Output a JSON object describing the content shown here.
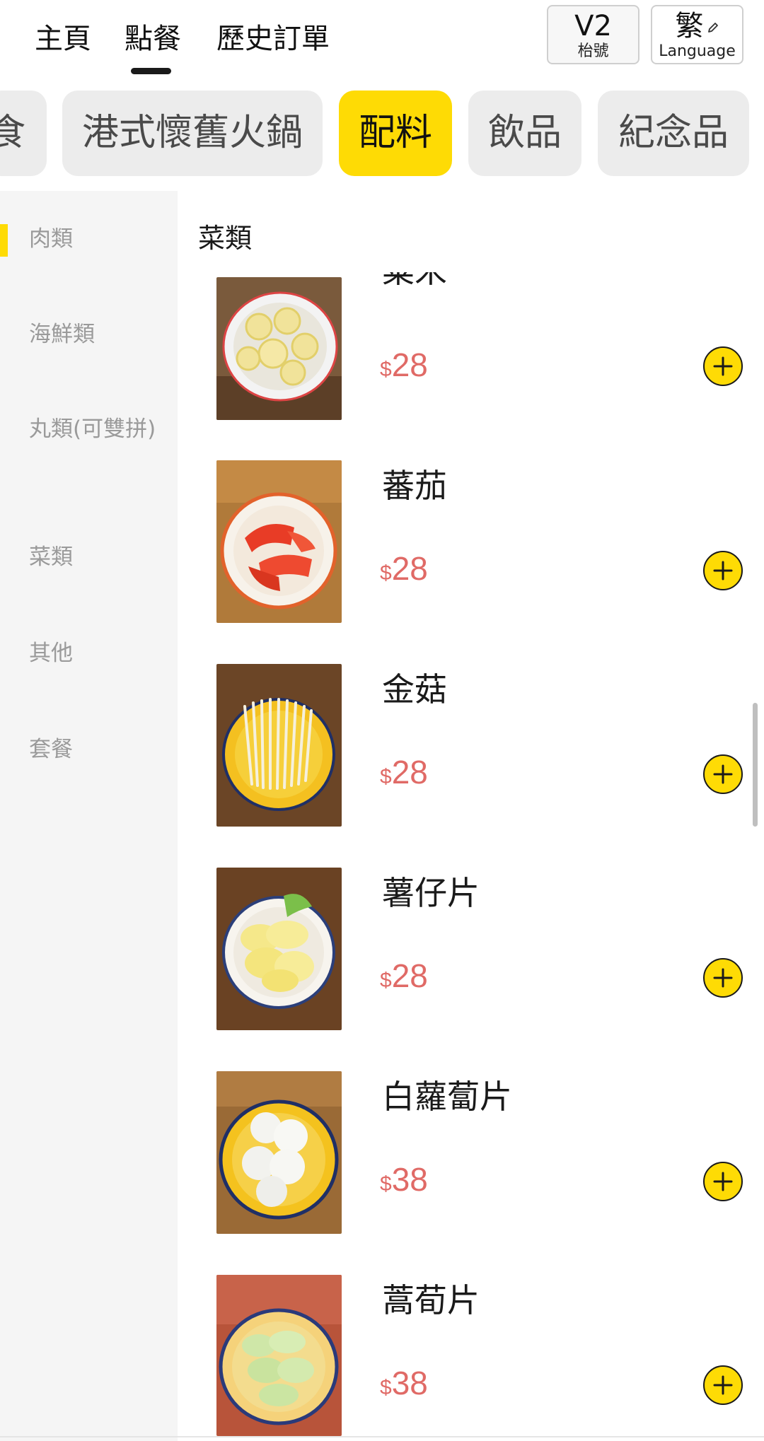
{
  "nav": {
    "tabs": [
      {
        "label": "主頁"
      },
      {
        "label": "點餐"
      },
      {
        "label": "歷史訂單"
      }
    ],
    "active_tab": "點餐",
    "table_button": {
      "code": "V2",
      "label": "枱號"
    },
    "language_button": {
      "code": "繁",
      "label": "Language",
      "icon": "pencil-icon"
    }
  },
  "categories": [
    {
      "label": "食"
    },
    {
      "label": "港式懷舊火鍋"
    },
    {
      "label": "配料"
    },
    {
      "label": "飲品"
    },
    {
      "label": "紀念品"
    }
  ],
  "active_category": "配料",
  "sidebar": {
    "items": [
      {
        "label": "肉類"
      },
      {
        "label": "海鮮類"
      },
      {
        "label": "丸類(可雙拼)"
      },
      {
        "label": "菜類"
      },
      {
        "label": "其他"
      },
      {
        "label": "套餐"
      }
    ],
    "active": "肉類"
  },
  "section": {
    "title": "菜類"
  },
  "items": [
    {
      "name": "粟米",
      "currency": "$",
      "price": "28",
      "image": "corn"
    },
    {
      "name": "蕃茄",
      "currency": "$",
      "price": "28",
      "image": "tomato"
    },
    {
      "name": "金菇",
      "currency": "$",
      "price": "28",
      "image": "enoki"
    },
    {
      "name": "薯仔片",
      "currency": "$",
      "price": "28",
      "image": "potato"
    },
    {
      "name": "白蘿蔔片",
      "currency": "$",
      "price": "38",
      "image": "radish"
    },
    {
      "name": "蒿荀片",
      "currency": "$",
      "price": "38",
      "image": "lettuce-stem"
    }
  ],
  "colors": {
    "accent": "#fedb05",
    "price": "#e06a66",
    "sidebar_bg": "#f5f5f5",
    "pill_bg": "#ececec"
  }
}
